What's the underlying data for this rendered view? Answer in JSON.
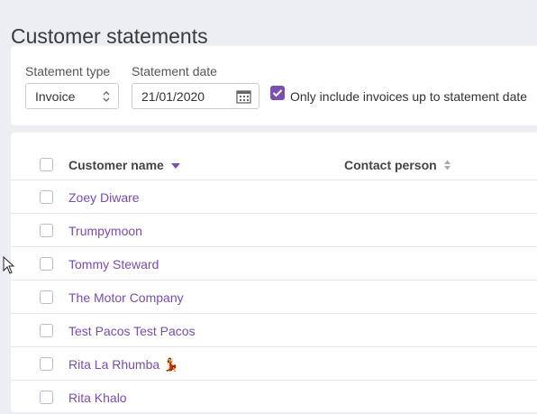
{
  "page": {
    "title": "Customer statements"
  },
  "filters": {
    "statement_type_label": "Statement type",
    "statement_type_value": "Invoice",
    "statement_date_label": "Statement date",
    "statement_date_value": "21/01/2020",
    "only_include_label": "Only include invoices up to statement date",
    "only_include_checked": true
  },
  "table": {
    "columns": {
      "customer_name": "Customer name",
      "contact_person": "Contact person"
    },
    "sort": {
      "column": "customer_name",
      "direction": "desc"
    },
    "rows": [
      {
        "name": "Zoey Diware"
      },
      {
        "name": "Trumpymoon"
      },
      {
        "name": "Tommy Steward"
      },
      {
        "name": "The Motor Company"
      },
      {
        "name": "Test Pacos Test Pacos"
      },
      {
        "name": "Rita La Rhumba",
        "emoji": "💃"
      },
      {
        "name": "Rita Khalo"
      }
    ]
  },
  "colors": {
    "accent": "#7b4fb0",
    "link": "#7a4cab",
    "background": "#eceef3"
  }
}
